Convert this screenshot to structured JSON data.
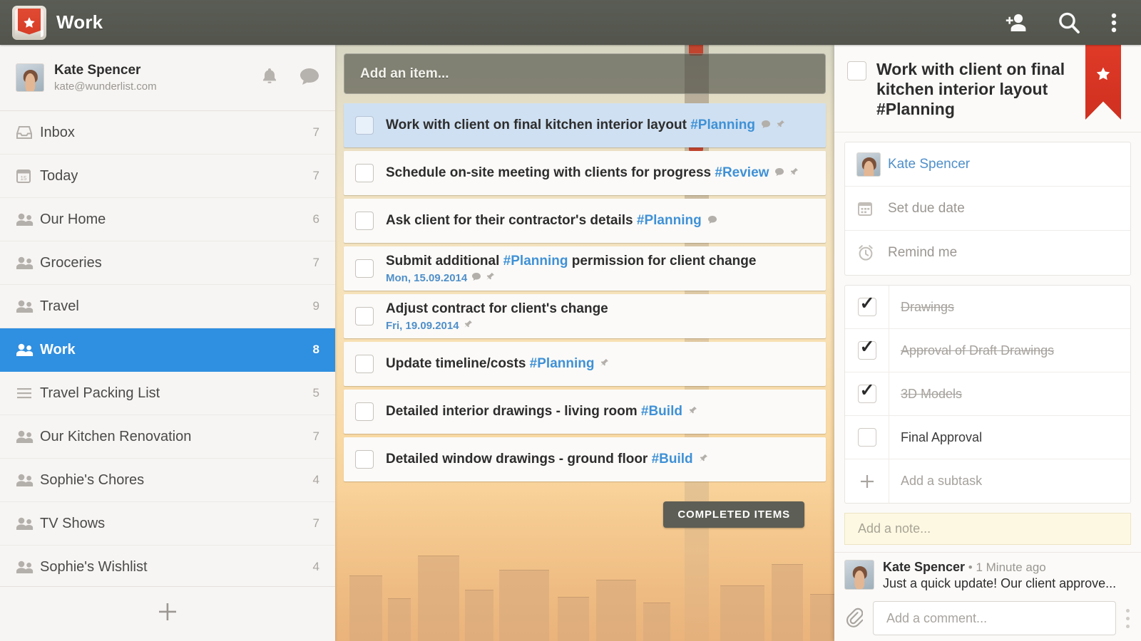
{
  "topbar": {
    "title": "Work",
    "logo_icon": "wunderlist-star-logo",
    "actions": [
      {
        "icon": "add-person-icon",
        "name": "add-person-button"
      },
      {
        "icon": "search-icon",
        "name": "search-button"
      },
      {
        "icon": "overflow-menu-icon",
        "name": "overflow-menu-button"
      }
    ]
  },
  "sidebar": {
    "user": {
      "name": "Kate Spencer",
      "email": "kate@wunderlist.com",
      "bell_icon": "bell-icon",
      "chat_icon": "chat-bubble-icon"
    },
    "items": [
      {
        "label": "Inbox",
        "count": "7",
        "icon": "inbox-icon",
        "selected": false
      },
      {
        "label": "Today",
        "count": "7",
        "icon": "calendar-icon",
        "selected": false
      },
      {
        "label": "Our Home",
        "count": "6",
        "icon": "people-icon",
        "selected": false
      },
      {
        "label": "Groceries",
        "count": "7",
        "icon": "people-icon",
        "selected": false
      },
      {
        "label": "Travel",
        "count": "9",
        "icon": "people-icon",
        "selected": false
      },
      {
        "label": "Work",
        "count": "8",
        "icon": "people-icon",
        "selected": true
      },
      {
        "label": "Travel Packing List",
        "count": "5",
        "icon": "list-icon",
        "selected": false
      },
      {
        "label": "Our Kitchen Renovation",
        "count": "7",
        "icon": "people-icon",
        "selected": false
      },
      {
        "label": "Sophie's Chores",
        "count": "4",
        "icon": "people-icon",
        "selected": false
      },
      {
        "label": "TV Shows",
        "count": "7",
        "icon": "people-icon",
        "selected": false
      },
      {
        "label": "Sophie's Wishlist",
        "count": "4",
        "icon": "people-icon",
        "selected": false
      }
    ],
    "add_list_icon": "plus-icon"
  },
  "center": {
    "add_item_placeholder": "Add an item...",
    "completed_items_label": "COMPLETED ITEMS",
    "tasks": [
      {
        "text_before": "Work with client on final kitchen interior layout ",
        "tag": "#Planning",
        "text_after": "",
        "date": "",
        "selected": true,
        "icons": [
          "comment-icon",
          "pin-icon"
        ]
      },
      {
        "text_before": "Schedule on-site meeting with clients for progress ",
        "tag": "#Review",
        "text_after": "",
        "date": "",
        "selected": false,
        "icons": [
          "comment-icon",
          "pin-icon"
        ]
      },
      {
        "text_before": "Ask client for their contractor's details ",
        "tag": "#Planning",
        "text_after": "",
        "date": "",
        "selected": false,
        "icons": [
          "comment-icon"
        ]
      },
      {
        "text_before": "Submit additional ",
        "tag": "#Planning",
        "text_after": " permission for client change",
        "date": "Mon, 15.09.2014",
        "selected": false,
        "icons": [
          "comment-icon",
          "pin-icon"
        ]
      },
      {
        "text_before": "Adjust contract for client's change",
        "tag": "",
        "text_after": "",
        "date": "Fri, 19.09.2014",
        "selected": false,
        "icons": [
          "pin-icon"
        ]
      },
      {
        "text_before": "Update timeline/costs ",
        "tag": "#Planning",
        "text_after": "",
        "date": "",
        "selected": false,
        "icons": [
          "pin-icon"
        ]
      },
      {
        "text_before": "Detailed interior drawings - living room ",
        "tag": "#Build",
        "text_after": "",
        "date": "",
        "selected": false,
        "icons": [
          "pin-icon"
        ]
      },
      {
        "text_before": "Detailed window drawings - ground floor ",
        "tag": "#Build",
        "text_after": "",
        "date": "",
        "selected": false,
        "icons": [
          "pin-icon"
        ]
      }
    ]
  },
  "detail": {
    "title": "Work with client on final kitchen interior layout #Planning",
    "star_icon": "star-ribbon-icon",
    "assignee": {
      "name": "Kate Spencer",
      "icon": "avatar"
    },
    "due_date_label": "Set due date",
    "due_date_icon": "calendar-icon",
    "reminder_label": "Remind me",
    "reminder_icon": "alarm-clock-icon",
    "subtasks": [
      {
        "label": "Drawings",
        "done": true
      },
      {
        "label": "Approval of Draft Drawings",
        "done": true
      },
      {
        "label": "3D Models",
        "done": true
      },
      {
        "label": "Final Approval",
        "done": false
      }
    ],
    "add_subtask_label": "Add a subtask",
    "add_subtask_icon": "plus-icon",
    "note_placeholder": "Add a note...",
    "comment": {
      "author": "Kate Spencer",
      "time": "• 1 Minute ago",
      "text": "Just a quick update! Our client approve..."
    },
    "comment_placeholder": "Add a comment...",
    "attach_icon": "paperclip-icon"
  },
  "colors": {
    "accent_blue": "#2f8fe0",
    "tag_blue": "#3f91d6",
    "brand_red": "#e03a28",
    "topbar": "#575a52",
    "note_yellow": "#fdf8e2"
  }
}
